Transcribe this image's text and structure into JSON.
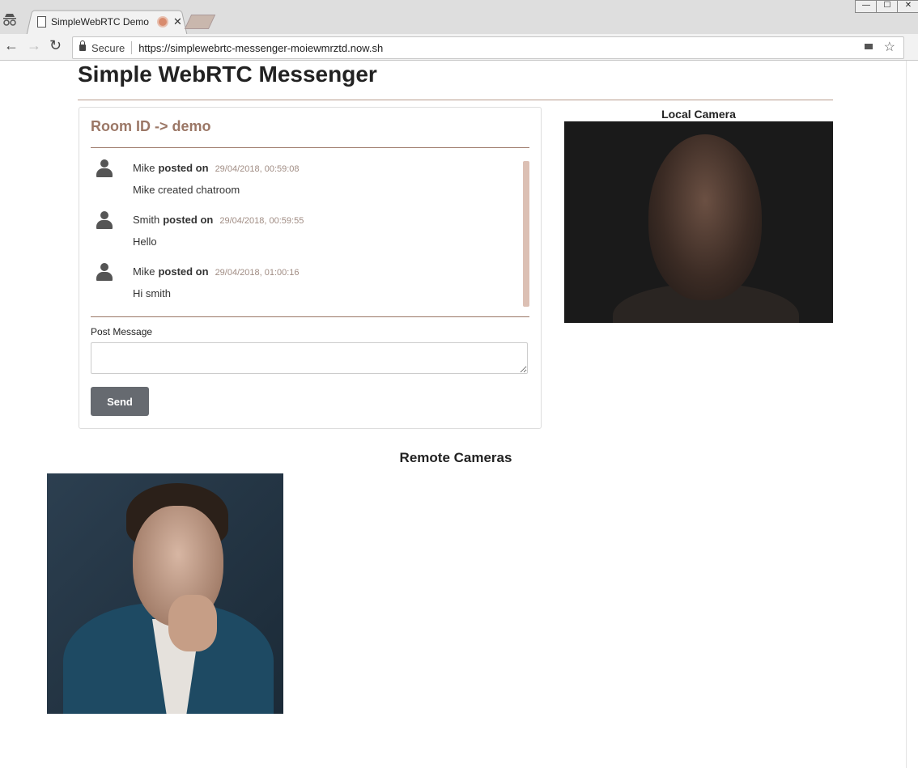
{
  "browser": {
    "tab_title": "SimpleWebRTC Demo",
    "tab_close": "✕",
    "security_label": "Secure",
    "url": "https://simplewebrtc-messenger-moiewmrztd.now.sh",
    "window_controls": [
      "—",
      "☐",
      "✕"
    ]
  },
  "page": {
    "title": "Simple WebRTC Messenger"
  },
  "chat": {
    "room_label": "Room ID -> demo",
    "messages": [
      {
        "author": "Mike",
        "posted": "posted on",
        "timestamp": "29/04/2018, 00:59:08",
        "text": "Mike created chatroom"
      },
      {
        "author": "Smith",
        "posted": "posted on",
        "timestamp": "29/04/2018, 00:59:55",
        "text": "Hello"
      },
      {
        "author": "Mike",
        "posted": "posted on",
        "timestamp": "29/04/2018, 01:00:16",
        "text": "Hi smith"
      }
    ],
    "post_label": "Post Message",
    "post_value": "",
    "send_label": "Send"
  },
  "cameras": {
    "local_label": "Local Camera",
    "remote_label": "Remote Cameras"
  }
}
